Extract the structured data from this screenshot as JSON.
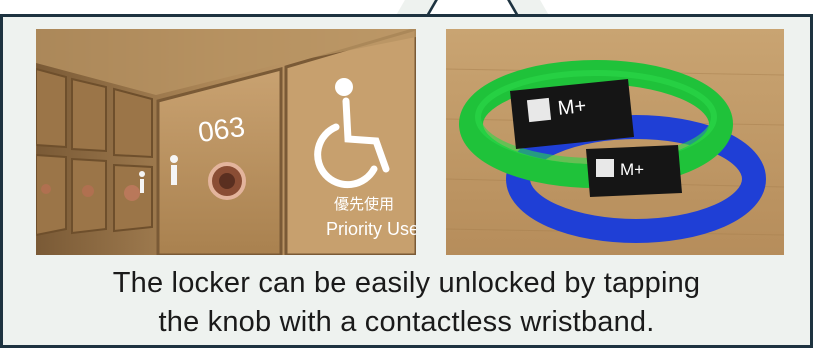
{
  "locker_photo": {
    "locker_number": "063",
    "label_cjk": "優先使用",
    "label_en": "Priority Use"
  },
  "wristband_photo": {
    "brand_mark": "M+",
    "band_colors": [
      "#1fc23a",
      "#1f3fd6"
    ]
  },
  "caption": {
    "line1": "The locker can be easily unlocked by tapping",
    "line2": "the knob with a contactless wristband."
  }
}
